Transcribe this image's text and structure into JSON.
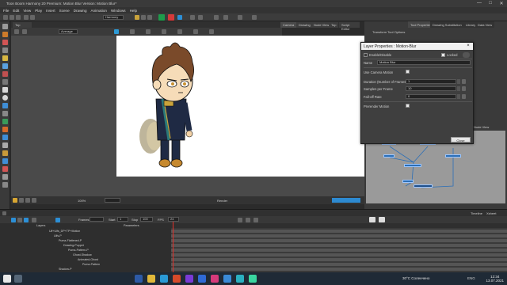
{
  "window": {
    "title": "Toon Boom Harmony 20 Premium: Motion Blur Version: Motion Blur*",
    "controls": [
      "—",
      "□",
      "✕"
    ]
  },
  "menu": [
    "File",
    "Edit",
    "View",
    "Play",
    "Insert",
    "Scene",
    "Drawing",
    "Animation",
    "Windows",
    "Help"
  ],
  "toolbar": {
    "workspace": "Harmony",
    "view_mode": "Average",
    "zoom": "100%"
  },
  "view_tabs": [
    "Camera",
    "Drawing",
    "Node View",
    "Top",
    "Script Editor"
  ],
  "canvas_header": "Top",
  "viewbar": {
    "zoom": "100%",
    "frame": "",
    "scene_field": "Render"
  },
  "right_tabs": [
    "Tool Properties",
    "Drawing Substitution",
    "Library",
    "Data View"
  ],
  "right_panel_label": "Transform Tool Options",
  "node_view_label": "Node View",
  "dialog": {
    "title": "Layer Properties : Motion-Blur",
    "enable_label": "Enable/Disable",
    "locked_label": "Locked",
    "name_label": "Name",
    "name_value": "Motion Blur",
    "use_camera_label": "Use Camera Motion",
    "duration_label": "Duration (Number of Frames)",
    "duration_value": "1",
    "samples_label": "Samples per Frame",
    "samples_value": "10",
    "falloff_label": "Fall-off Rate",
    "falloff_value": "0",
    "prerender_label": "Prerender Motion",
    "close_label": "Close"
  },
  "timeline": {
    "tabs": [
      "Timeline",
      "Xsheet"
    ],
    "frames_label": "Frames",
    "start_label": "Start",
    "start_value": "1",
    "stop_label": "Stop",
    "stop_value": "100",
    "fps_label": "FPS",
    "fps_value": "24",
    "layers_header": "Layers",
    "params_header": "Parameters",
    "layers": [
      "Ulf+Ulfs_DP+TP+Motion",
      "Ulfs-P",
      "Puma-Flattened-P",
      "Drawing-Puppet",
      "Puma-Pattern-P",
      "Ghost-Shadow",
      "Animated-Ghost",
      "Puma-Pattern",
      "Shadow-P",
      "Chicken-P"
    ]
  },
  "taskbar": {
    "weather": "30°C  Соленчено",
    "lang": "ENG",
    "time": "12:34",
    "date": "13.07.2021"
  },
  "colors": {
    "accent_blue": "#2c6fb7",
    "playhead": "#e0312a",
    "canvas_bg": "#ffffff"
  }
}
